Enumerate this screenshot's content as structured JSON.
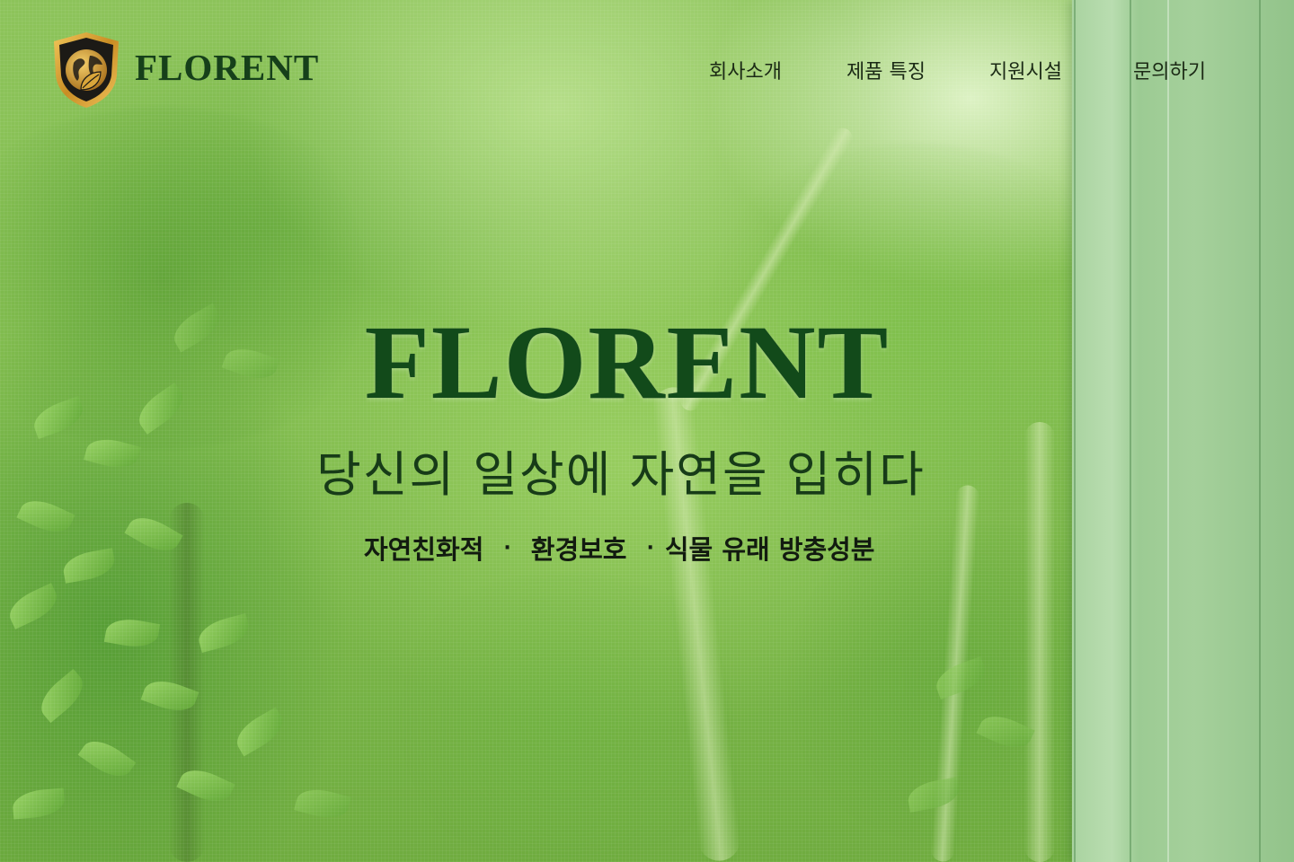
{
  "header": {
    "brand": "FLORENT",
    "nav": [
      {
        "label": "회사소개"
      },
      {
        "label": "제품 특징"
      },
      {
        "label": "지원시설"
      },
      {
        "label": "문의하기"
      }
    ]
  },
  "hero": {
    "title": "FLORENT",
    "subtitle": "당신의 일상에 자연을 입히다",
    "features": [
      "자연친화적",
      "환경보호",
      "식물 유래 방충성분"
    ],
    "separator": "·"
  },
  "icons": {
    "logo": "shield-globe-leaf-icon"
  },
  "colors": {
    "brand_green": "#124a1a",
    "nav_text": "#1b2a15",
    "logo_gold": "#d9a63a",
    "logo_dark": "#1a1a1a"
  }
}
